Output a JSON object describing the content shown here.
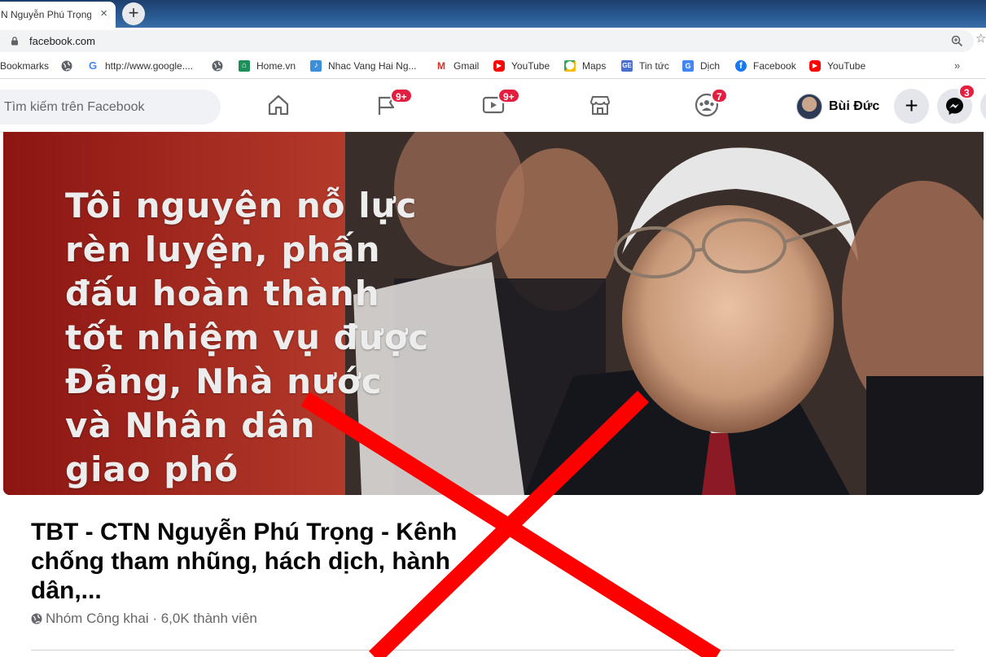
{
  "browser": {
    "tab_title": "N Nguyễn Phú Trọng",
    "tab_close": "×",
    "new_tab": "+",
    "url": "facebook.com"
  },
  "bookmarks": [
    {
      "label": "Bookmarks",
      "icon": "none"
    },
    {
      "label": "",
      "icon": "globe-icon"
    },
    {
      "label": "http://www.google....",
      "icon": "google-icon"
    },
    {
      "label": "",
      "icon": "globe-icon"
    },
    {
      "label": "Home.vn",
      "icon": "home-icon"
    },
    {
      "label": "Nhac Vang Hai Ng...",
      "icon": "music-icon"
    },
    {
      "label": "Gmail",
      "icon": "gmail-icon"
    },
    {
      "label": "YouTube",
      "icon": "youtube-icon"
    },
    {
      "label": "Maps",
      "icon": "maps-icon"
    },
    {
      "label": "Tin tức",
      "icon": "news-icon"
    },
    {
      "label": "Dịch",
      "icon": "translate-icon"
    },
    {
      "label": "Facebook",
      "icon": "facebook-icon"
    },
    {
      "label": "YouTube",
      "icon": "youtube-icon"
    }
  ],
  "bookmarks_overflow": "»",
  "facebook_nav": {
    "search_placeholder": "Tìm kiếm trên Facebook",
    "pages_badge": "9+",
    "watch_badge": "9+",
    "groups_badge": "7",
    "messenger_badge": "3",
    "profile_name": "Bùi Đức",
    "create_label": "+"
  },
  "cover": {
    "quote_lines": [
      "Tôi nguyện nỗ lực",
      "rèn luyện, phấn",
      "đấu hoàn thành",
      "tốt nhiệm vụ được",
      "Đảng, Nhà nước",
      "và Nhân dân",
      "giao phó"
    ]
  },
  "group": {
    "title": "TBT - CTN Nguyễn Phú Trọng - Kênh chống tham nhũng, hách dịch, hành dân,...",
    "meta": "Nhóm Công khai · 6,0K thành viên"
  },
  "colors": {
    "badge": "#e41e3f",
    "overlay_x": "#ff0000",
    "facebook_blue": "#1877f2"
  }
}
